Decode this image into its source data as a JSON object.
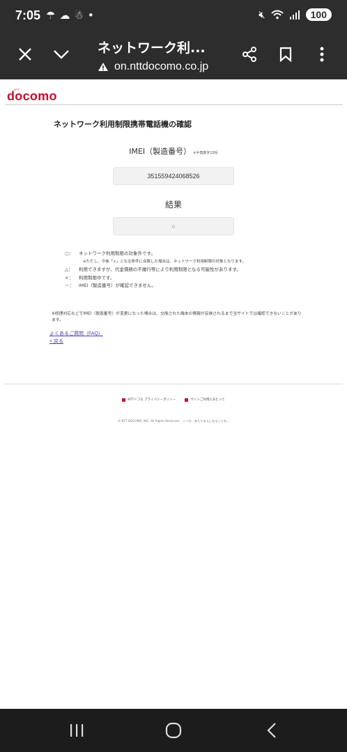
{
  "status_bar": {
    "time": "7:05",
    "battery": "100",
    "left_icons": [
      "weather-icon",
      "cloud-icon",
      "notification-icon",
      "dot-icon"
    ],
    "right_icons": [
      "mute-vibrate-icon",
      "wifi-icon",
      "signal-icon"
    ]
  },
  "browser_toolbar": {
    "title": "ネットワーク利...",
    "url": "on.nttdocomo.co.jp",
    "icons": [
      "close-icon",
      "chevron-down-icon",
      "share-icon",
      "bookmark-icon",
      "more-icon"
    ]
  },
  "page": {
    "logo_small": "NTT",
    "logo": "docomo",
    "heading": "ネットワーク利用制限携帯電話機の確認",
    "imei_label": "IMEI（製造番号）",
    "imei_note": "※半角数字15桁",
    "imei_value": "351559424068526",
    "result_label": "結果",
    "result_value": "○",
    "legend": [
      {
        "symbol": "○：",
        "text": "ネットワーク利用制限の対象外です。"
      },
      {
        "symbol": "",
        "text": "※ただし、今後「×」となる条件に合致した場合は、ネットワーク利用制限の対象となります。"
      },
      {
        "symbol": "△：",
        "text": "利用できますが、代金債務の不履行等により利用制限となる可能性があります。"
      },
      {
        "symbol": "×：",
        "text": "利用制限中です。"
      },
      {
        "symbol": "－：",
        "text": "IMEI（製造番号）が確認できません。"
      }
    ],
    "note": "※修理対応などでIMEI（製造番号）が変更になった場合は、交換された端末の情報が反映されるまで当サイトでは確認できないことがあります。",
    "faq_link": "よくあるご質問（FAQ）",
    "back_link": "< 戻る",
    "footer_links": [
      "NTTドコモ プライバシーポリシー",
      "サイトご利用にあたって"
    ],
    "copyright": "© NTT DOCOMO, INC. All Rights Reserved.　いつか、あたりまえになることを。"
  },
  "nav_bar": {
    "icons": [
      "recent-apps-icon",
      "home-icon",
      "back-icon"
    ]
  }
}
